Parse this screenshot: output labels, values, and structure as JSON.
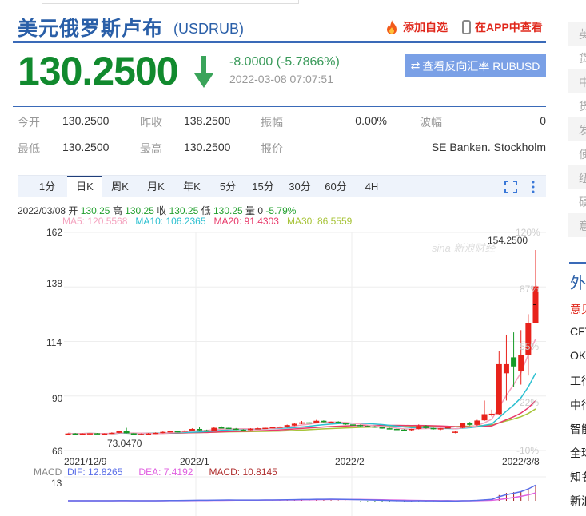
{
  "header": {
    "title": "美元俄罗斯卢布",
    "code": "(USDRUB)",
    "add_fav": "添加自选",
    "view_app": "在APP中查看"
  },
  "quote": {
    "price": "130.2500",
    "change": "-8.0000 (-5.7866%)",
    "time": "2022-03-08 07:07:51",
    "reverse_button": "查看反向汇率 RUBUSD"
  },
  "stats": [
    {
      "label": "今开",
      "value": "130.2500"
    },
    {
      "label": "昨收",
      "value": "138.2500"
    },
    {
      "label": "振幅",
      "value": "0.00%"
    },
    {
      "label": "波幅",
      "value": "0"
    },
    {
      "label": "最低",
      "value": "130.2500"
    },
    {
      "label": "最高",
      "value": "130.2500"
    },
    {
      "label": "报价",
      "value": "SE Banken. Stockholm"
    }
  ],
  "tabs": [
    "1分",
    "日K",
    "周K",
    "月K",
    "年K",
    "5分",
    "15分",
    "30分",
    "60分",
    "4H"
  ],
  "active_tab": "日K",
  "info": {
    "date": "2022/03/08",
    "open_l": "开",
    "open": "130.25",
    "high_l": "高",
    "high": "130.25",
    "close_l": "收",
    "close": "130.25",
    "low_l": "低",
    "low": "130.25",
    "vol_l": "量",
    "vol": "0",
    "pct": "-5.79%"
  },
  "ma": {
    "ma5": "MA5: 120.5568",
    "ma10": "MA10: 106.2365",
    "ma20": "MA20: 91.4303",
    "ma30": "MA30: 86.5559"
  },
  "macd": {
    "label": "MACD",
    "dif": "DIF: 12.8265",
    "dea": "DEA: 7.4192",
    "macd": "MACD: 10.8145",
    "axis": "13"
  },
  "colors": {
    "up": "#e8221b",
    "down": "#159a27",
    "ma5": "#f4a3bf",
    "ma10": "#2cc0d0",
    "ma20": "#e8396a",
    "ma30": "#a8c43a",
    "dif": "#5a6ee8",
    "dea": "#e060e0",
    "macd_bar": "#a01818"
  },
  "chart_data": {
    "type": "candlestick",
    "ylim": [
      66,
      162
    ],
    "yticks": [
      "162",
      "138",
      "114",
      "90",
      "66"
    ],
    "pct_ticks": [
      "120%",
      "87%",
      "55%",
      "22%",
      "-10%"
    ],
    "xlabels": [
      "2021/12/9",
      "2022/1",
      "2022/2",
      "2022/3/8"
    ],
    "max_label": "154.2500",
    "min_label": "73.0470",
    "ohlc": [
      [
        73.4,
        73.6,
        73.2,
        73.5
      ],
      [
        73.5,
        73.7,
        73.3,
        73.4
      ],
      [
        73.4,
        73.6,
        73.2,
        73.5
      ],
      [
        73.5,
        73.8,
        73.3,
        73.6
      ],
      [
        73.6,
        73.7,
        73.2,
        73.3
      ],
      [
        73.3,
        73.6,
        73.1,
        73.5
      ],
      [
        73.5,
        74.0,
        73.3,
        73.8
      ],
      [
        73.8,
        74.8,
        73.6,
        74.5
      ],
      [
        74.5,
        76.0,
        73.5,
        73.6
      ],
      [
        73.6,
        73.8,
        73.05,
        73.0
      ],
      [
        73.0,
        73.5,
        72.9,
        73.3
      ],
      [
        73.3,
        73.7,
        73.1,
        73.5
      ],
      [
        73.5,
        74.0,
        73.3,
        73.8
      ],
      [
        73.8,
        74.4,
        73.6,
        74.2
      ],
      [
        74.2,
        74.8,
        74.0,
        74.5
      ],
      [
        74.5,
        74.6,
        74.0,
        74.3
      ],
      [
        74.3,
        75.0,
        74.1,
        74.8
      ],
      [
        74.8,
        75.8,
        74.6,
        75.5
      ],
      [
        75.5,
        76.5,
        74.7,
        74.9
      ],
      [
        74.9,
        75.2,
        74.5,
        74.8
      ],
      [
        74.8,
        76.2,
        74.6,
        76.0
      ],
      [
        76.2,
        76.7,
        75.8,
        76.0
      ],
      [
        76.0,
        76.1,
        75.6,
        75.8
      ],
      [
        75.6,
        75.9,
        75.0,
        75.2
      ],
      [
        75.2,
        75.4,
        74.9,
        75.0
      ],
      [
        75.0,
        75.8,
        74.9,
        75.6
      ],
      [
        75.6,
        76.0,
        75.4,
        75.8
      ],
      [
        75.8,
        76.1,
        75.6,
        76.0
      ],
      [
        76.0,
        76.4,
        75.8,
        76.3
      ],
      [
        76.3,
        76.6,
        76.0,
        76.5
      ],
      [
        76.3,
        77.4,
        76.1,
        77.2
      ],
      [
        77.0,
        78.0,
        76.8,
        77.8
      ],
      [
        77.8,
        79.0,
        77.6,
        78.4
      ],
      [
        78.4,
        78.6,
        78.0,
        78.1
      ],
      [
        78.3,
        79.5,
        78.1,
        79.1
      ],
      [
        79.1,
        79.3,
        78.4,
        78.5
      ],
      [
        78.5,
        78.8,
        78.2,
        78.7
      ],
      [
        78.7,
        78.9,
        77.9,
        78.0
      ],
      [
        78.0,
        78.2,
        77.3,
        77.5
      ],
      [
        77.5,
        77.7,
        77.0,
        77.2
      ],
      [
        77.2,
        77.4,
        76.6,
        76.8
      ],
      [
        76.8,
        77.0,
        76.4,
        76.6
      ],
      [
        76.6,
        76.8,
        76.0,
        76.2
      ],
      [
        76.2,
        76.4,
        75.6,
        75.8
      ],
      [
        75.8,
        76.0,
        75.3,
        75.5
      ],
      [
        75.5,
        75.7,
        75.0,
        75.2
      ],
      [
        75.2,
        75.4,
        74.8,
        75.0
      ],
      [
        75.0,
        75.6,
        74.7,
        75.5
      ],
      [
        75.5,
        77.5,
        75.3,
        76.8
      ],
      [
        76.8,
        77.2,
        75.6,
        75.9
      ],
      [
        75.9,
        76.1,
        75.2,
        75.5
      ],
      [
        75.5,
        75.9,
        75.0,
        75.8
      ],
      [
        75.8,
        76.3,
        75.6,
        76.2
      ],
      [
        74.0,
        74.5,
        73.6,
        74.3
      ],
      [
        76.0,
        78.3,
        75.8,
        78.2
      ],
      [
        78.3,
        78.6,
        77.0,
        77.3
      ],
      [
        77.3,
        79.5,
        77.0,
        79.2
      ],
      [
        79.3,
        88.0,
        79.0,
        82.0
      ],
      [
        82.0,
        84.0,
        81.0,
        82.2
      ],
      [
        82.0,
        109.6,
        81.5,
        104.0
      ],
      [
        100.0,
        117.0,
        88.0,
        104.0
      ],
      [
        107.0,
        118.0,
        94.0,
        103.0
      ],
      [
        101.0,
        119.0,
        95.0,
        108.0
      ],
      [
        108.0,
        126.0,
        99.0,
        122.0
      ],
      [
        122.0,
        154.25,
        122.0,
        138.25
      ]
    ],
    "last": 130.25
  },
  "sidebar": {
    "boxes": [
      "英",
      "货",
      "中",
      "货",
      "发",
      "使",
      "纽",
      "硬",
      "意"
    ],
    "section": "外",
    "items": [
      "意见",
      "CFT",
      "OK",
      "工行",
      "中行",
      "智能",
      "全球",
      "知名",
      "新浪"
    ]
  }
}
